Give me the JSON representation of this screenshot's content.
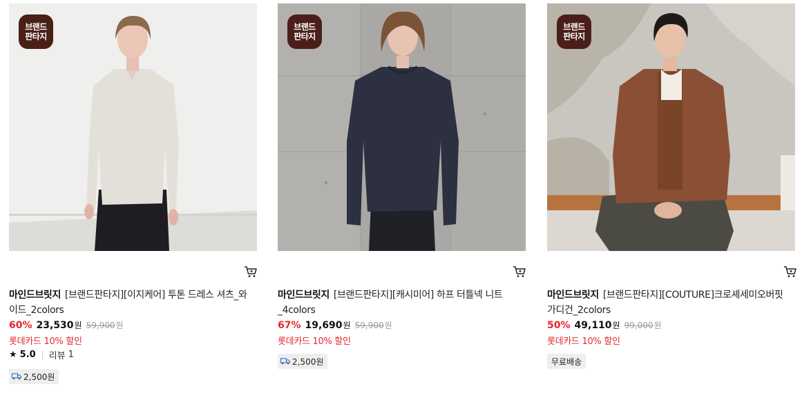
{
  "badge": {
    "line1": "브랜드",
    "line2": "판타지"
  },
  "products": [
    {
      "brand": "마인드브릿지",
      "name": "[브랜드판타지][이지케어] 투톤 드레스 셔츠_와이드_2colors",
      "discount": "60%",
      "sale_price": "23,530",
      "currency": "원",
      "original_price": "59,900",
      "card_promo": "롯데카드 10% 할인",
      "rating": "5.0",
      "review_label": "리뷰",
      "review_count": "1",
      "shipping": "2,500원",
      "icons": [
        "cart-icon",
        "star-icon",
        "truck-icon"
      ]
    },
    {
      "brand": "마인드브릿지",
      "name": "[브랜드판타지][캐시미어] 하프 터틀넥 니트_4colors",
      "discount": "67%",
      "sale_price": "19,690",
      "currency": "원",
      "original_price": "59,900",
      "card_promo": "롯데카드 10% 할인",
      "shipping": "2,500원",
      "icons": [
        "cart-icon",
        "truck-icon"
      ]
    },
    {
      "brand": "마인드브릿지",
      "name": "[브랜드판타지][COUTURE]크로셰세미오버핏가디건_2colors",
      "discount": "50%",
      "sale_price": "49,110",
      "currency": "원",
      "original_price": "99,000",
      "card_promo": "롯데카드 10% 할인",
      "shipping": "무료배송",
      "icons": [
        "cart-icon"
      ]
    }
  ],
  "colors": {
    "discount_red": "#e4272b",
    "badge_brown": "#4a1f17",
    "tag_gray": "#eeeeee",
    "strike_gray": "#999999"
  }
}
